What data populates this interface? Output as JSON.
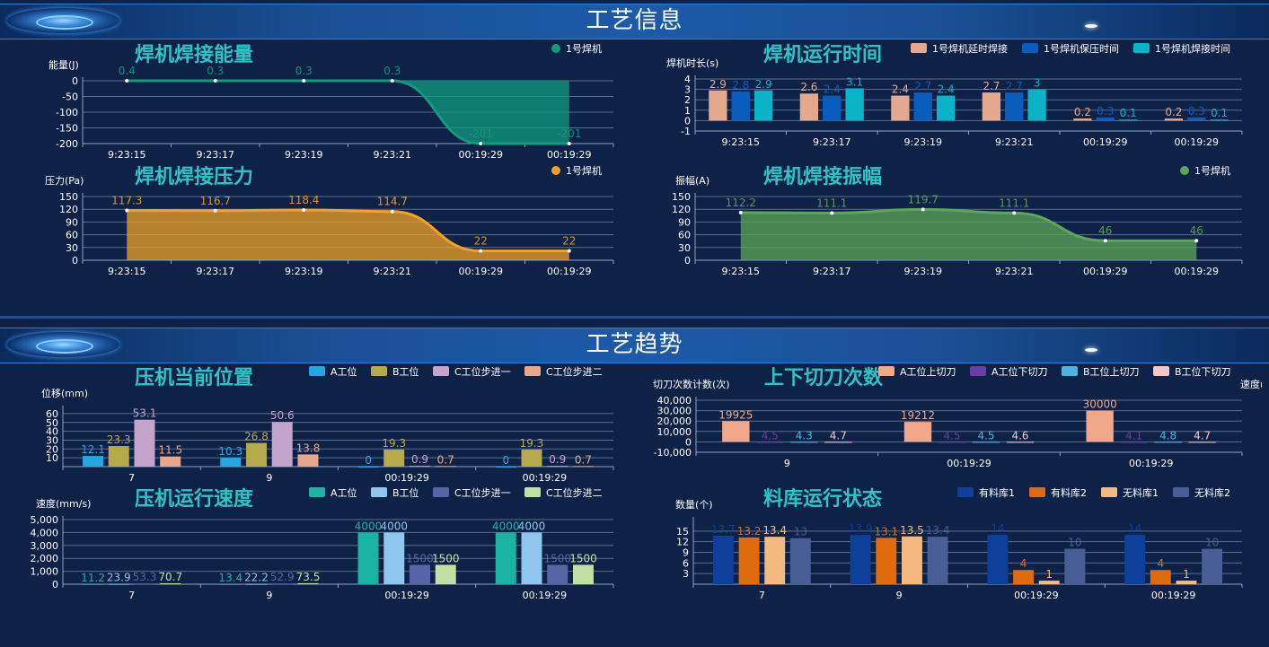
{
  "sections": {
    "info_title": "工艺信息",
    "trend_title": "工艺趋势"
  },
  "panels": {
    "energy": {
      "title": "焊机焊接能量",
      "chart_data": {
        "type": "area",
        "ylabel": "能量(J)",
        "categories": [
          "9:23:15",
          "9:23:17",
          "9:23:19",
          "9:23:21",
          "00:19:29",
          "00:19:29"
        ],
        "series": [
          {
            "name": "1号焊机",
            "values": [
              0.4,
              0.3,
              0.3,
              0.3,
              -201,
              -201
            ],
            "labels": [
              "0.4",
              "0.3",
              "0.3",
              "0.3",
              "-201",
              "-201"
            ],
            "color": "#129a7e"
          }
        ],
        "ylim": [
          -200,
          0
        ],
        "yticks": [
          0,
          -50,
          -100,
          -150,
          -200
        ],
        "grid": true,
        "legend": "top-right"
      }
    },
    "runtime": {
      "title": "焊机运行时间",
      "chart_data": {
        "type": "bar",
        "ylabel": "焊机时长(s)",
        "categories": [
          "9:23:15",
          "9:23:17",
          "9:23:19",
          "9:23:21",
          "00:19:29",
          "00:19:29"
        ],
        "series": [
          {
            "name": "1号焊机延时焊接",
            "values": [
              2.9,
              2.6,
              2.4,
              2.7,
              0.2,
              0.2
            ],
            "color": "#e4a88f"
          },
          {
            "name": "1号焊机保压时间",
            "values": [
              2.8,
              2.4,
              2.7,
              2.7,
              0.3,
              0.3
            ],
            "color": "#0b5dbd"
          },
          {
            "name": "1号焊机焊接时间",
            "values": [
              2.9,
              3.1,
              2.4,
              3,
              0.1,
              0.1
            ],
            "color": "#0ab3c6"
          }
        ],
        "ylim": [
          -1,
          4
        ],
        "yticks": [
          4,
          3,
          2,
          1,
          0,
          -1
        ],
        "grid": true,
        "legend": "top-right"
      }
    },
    "pressure": {
      "title": "焊机焊接压力",
      "chart_data": {
        "type": "area",
        "ylabel": "压力(Pa)",
        "categories": [
          "9:23:15",
          "9:23:17",
          "9:23:19",
          "9:23:21",
          "00:19:29",
          "00:19:29"
        ],
        "series": [
          {
            "name": "1号焊机",
            "values": [
              117.3,
              116.7,
              118.4,
              114.7,
              22,
              22
            ],
            "color": "#f2a225"
          }
        ],
        "ylim": [
          0,
          150
        ],
        "yticks": [
          150,
          120,
          90,
          60,
          30,
          0
        ],
        "grid": true,
        "legend": "top-right"
      }
    },
    "vibration": {
      "title": "焊机焊接振幅",
      "chart_data": {
        "type": "area",
        "ylabel": "振幅(A)",
        "categories": [
          "9:23:15",
          "9:23:17",
          "9:23:19",
          "9:23:21",
          "00:19:29",
          "00:19:29"
        ],
        "series": [
          {
            "name": "1号焊机",
            "values": [
              112.2,
              111.1,
              119.7,
              111.1,
              46,
              46
            ],
            "color": "#5ea558"
          }
        ],
        "ylim": [
          0,
          150
        ],
        "yticks": [
          150,
          120,
          90,
          60,
          30,
          0
        ],
        "grid": true,
        "legend": "top-right"
      }
    },
    "position": {
      "title": "压机当前位置",
      "chart_data": {
        "type": "bar",
        "ylabel": "位移(mm)",
        "categories": [
          "7",
          "9",
          "00:19:29",
          "00:19:29"
        ],
        "series": [
          {
            "name": "A工位",
            "values": [
              12.1,
              10.3,
              0,
              0
            ],
            "color": "#25a6e3"
          },
          {
            "name": "B工位",
            "values": [
              23.3,
              26.8,
              19.3,
              19.3
            ],
            "color": "#b5a94a"
          },
          {
            "name": "C工位步进一",
            "values": [
              53.1,
              50.6,
              0.9,
              0.9
            ],
            "color": "#c4a3cc"
          },
          {
            "name": "C工位步进二",
            "values": [
              11.5,
              13.8,
              0.7,
              0.7
            ],
            "color": "#e8a88e"
          }
        ],
        "ylim": [
          0,
          65
        ],
        "yticks": [
          60,
          50,
          40,
          30,
          20,
          10
        ],
        "grid": true,
        "legend": "top-right"
      }
    },
    "cuts": {
      "title": "上下切刀次数",
      "chart_data": {
        "type": "bar",
        "ylabel": "切刀次数计数(次)",
        "ylabel_right": "速度(mn",
        "categories": [
          "9",
          "00:19:29",
          "00:19:29"
        ],
        "series": [
          {
            "name": "A工位上切刀",
            "values": [
              19925,
              19212,
              30000
            ],
            "labels": [
              "19925",
              "19212",
              "30000"
            ],
            "color": "#f1a78a"
          },
          {
            "name": "A工位下切刀",
            "values": [
              4.5,
              4.5,
              4.1
            ],
            "color": "#6b3fa0"
          },
          {
            "name": "B工位上切刀",
            "values": [
              4.3,
              4.5,
              4.8
            ],
            "color": "#4fb3dc"
          },
          {
            "name": "B工位下切刀",
            "values": [
              4.7,
              4.6,
              4.7
            ],
            "color": "#f3c6c6"
          }
        ],
        "ylim": [
          -10000,
          40000
        ],
        "yticks": [
          "40,000",
          "30,000",
          "20,000",
          "10,000",
          "0",
          "-10,000"
        ],
        "grid": true,
        "legend": "top-right"
      }
    },
    "speed": {
      "title": "压机运行速度",
      "chart_data": {
        "type": "bar",
        "ylabel": "速度(mm/s)",
        "categories": [
          "7",
          "9",
          "00:19:29",
          "00:19:29"
        ],
        "series": [
          {
            "name": "A工位",
            "values": [
              11.2,
              13.4,
              4000,
              4000
            ],
            "color": "#1bb3a4"
          },
          {
            "name": "B工位",
            "values": [
              23.9,
              22.2,
              4000,
              4000
            ],
            "color": "#8ec6ee"
          },
          {
            "name": "C工位步进一",
            "values": [
              53.3,
              52.9,
              1500,
              1500
            ],
            "color": "#5566a6"
          },
          {
            "name": "C工位步进二",
            "values": [
              70.7,
              73.5,
              1500,
              1500
            ],
            "color": "#c3e0a4"
          }
        ],
        "ylim": [
          0,
          5000
        ],
        "yticks": [
          "5,000",
          "4,000",
          "3,000",
          "2,000",
          "1,000",
          "0"
        ],
        "grid": true,
        "legend": "top-right"
      }
    },
    "storage": {
      "title": "料库运行状态",
      "chart_data": {
        "type": "bar",
        "ylabel": "数量(个)",
        "categories": [
          "7",
          "9",
          "00:19:29",
          "00:19:29"
        ],
        "series": [
          {
            "name": "有料库1",
            "values": [
              13.7,
              13.9,
              14,
              14
            ],
            "labels": [
              "13.7",
              "13.9",
              "14",
              "14"
            ],
            "color": "#0e3f9a"
          },
          {
            "name": "有料库2",
            "values": [
              13.2,
              13.1,
              4,
              4
            ],
            "color": "#e06b0c"
          },
          {
            "name": "无料库1",
            "values": [
              13.4,
              13.5,
              1,
              1
            ],
            "color": "#f4b97f"
          },
          {
            "name": "无料库2",
            "values": [
              13,
              13.4,
              10,
              10
            ],
            "labels": [
              "13",
              "13.4",
              "10",
              "10"
            ],
            "color": "#4a5e96"
          }
        ],
        "ylim": [
          0,
          18
        ],
        "yticks": [
          15,
          12,
          9,
          6,
          3
        ],
        "grid": true,
        "legend": "top-right"
      }
    }
  }
}
